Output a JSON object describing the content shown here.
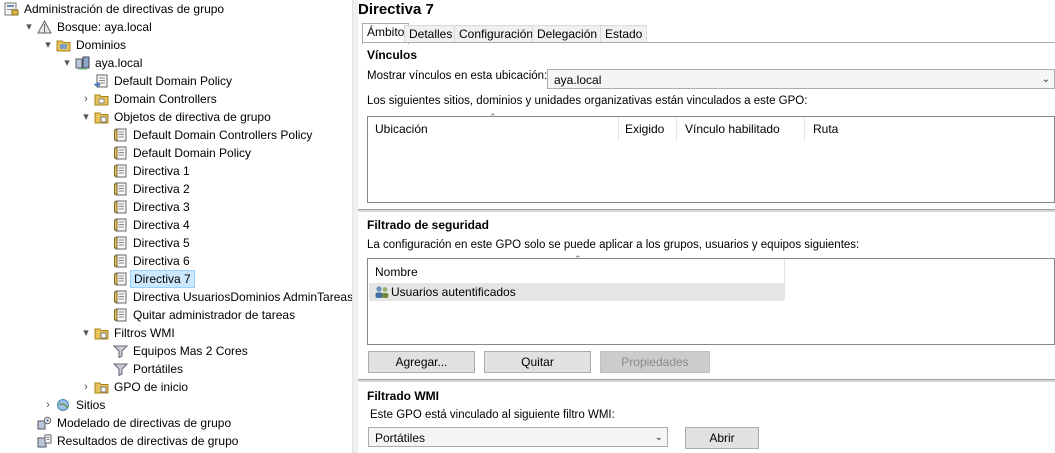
{
  "tree": {
    "nodes": [
      {
        "label": "Administración de directivas de grupo",
        "icon": "console-icon",
        "expander": ""
      },
      {
        "label": "Bosque: aya.local",
        "icon": "forest-icon",
        "expander": "▾"
      },
      {
        "label": "Dominios",
        "icon": "domains-folder-icon",
        "expander": "▾"
      },
      {
        "label": "aya.local",
        "icon": "domain-icon",
        "expander": "▾"
      },
      {
        "label": "Default Domain Policy",
        "icon": "gpo-link-icon",
        "expander": ""
      },
      {
        "label": "Domain Controllers",
        "icon": "ou-folder-icon",
        "expander": "›"
      },
      {
        "label": "Objetos de directiva de grupo",
        "icon": "folder-icon",
        "expander": "▾"
      },
      {
        "label": "Default Domain Controllers Policy",
        "icon": "gpo-icon",
        "expander": ""
      },
      {
        "label": "Default Domain Policy",
        "icon": "gpo-icon",
        "expander": ""
      },
      {
        "label": "Directiva 1",
        "icon": "gpo-icon",
        "expander": ""
      },
      {
        "label": "Directiva 2",
        "icon": "gpo-icon",
        "expander": ""
      },
      {
        "label": "Directiva 3",
        "icon": "gpo-icon",
        "expander": ""
      },
      {
        "label": "Directiva 4",
        "icon": "gpo-icon",
        "expander": ""
      },
      {
        "label": "Directiva 5",
        "icon": "gpo-icon",
        "expander": ""
      },
      {
        "label": "Directiva 6",
        "icon": "gpo-icon",
        "expander": ""
      },
      {
        "label": "Directiva 7",
        "icon": "gpo-icon",
        "expander": "",
        "selected": true
      },
      {
        "label": "Directiva UsuariosDominios AdminTareas",
        "icon": "gpo-icon",
        "expander": ""
      },
      {
        "label": "Quitar administrador de tareas",
        "icon": "gpo-icon",
        "expander": ""
      },
      {
        "label": "Filtros WMI",
        "icon": "folder-icon",
        "expander": "▾"
      },
      {
        "label": "Equipos Mas 2 Cores",
        "icon": "wmi-filter-icon",
        "expander": ""
      },
      {
        "label": "Portátiles",
        "icon": "wmi-filter-icon",
        "expander": ""
      },
      {
        "label": "GPO de inicio",
        "icon": "folder-icon",
        "expander": "›"
      },
      {
        "label": "Sitios",
        "icon": "sites-icon",
        "expander": "›"
      },
      {
        "label": "Modelado de directivas de grupo",
        "icon": "modeling-icon",
        "expander": ""
      },
      {
        "label": "Resultados de directivas de grupo",
        "icon": "results-icon",
        "expander": ""
      }
    ]
  },
  "gpo": {
    "title": "Directiva 7",
    "tabs": [
      "Ámbito",
      "Detalles",
      "Configuración",
      "Delegación",
      "Estado"
    ],
    "links": {
      "title": "Vínculos",
      "show_label": "Mostrar vínculos en esta ubicación:",
      "location_value": "aya.local",
      "description": "Los siguientes sitios, dominios y unidades organizativas están vinculados a este GPO:",
      "columns": [
        "Ubicación",
        "Exigido",
        "Vínculo habilitado",
        "Ruta"
      ]
    },
    "security": {
      "title": "Filtrado de seguridad",
      "description": "La configuración en este GPO solo se puede aplicar a los grupos, usuarios y equipos siguientes:",
      "column": "Nombre",
      "entries": [
        "Usuarios autentificados"
      ],
      "buttons": {
        "add": "Agregar...",
        "remove": "Quitar",
        "properties": "Propiedades"
      }
    },
    "wmi": {
      "title": "Filtrado WMI",
      "description": "Este GPO está vinculado al siguiente filtro WMI:",
      "filter_value": "Portátiles",
      "open_label": "Abrir"
    }
  }
}
